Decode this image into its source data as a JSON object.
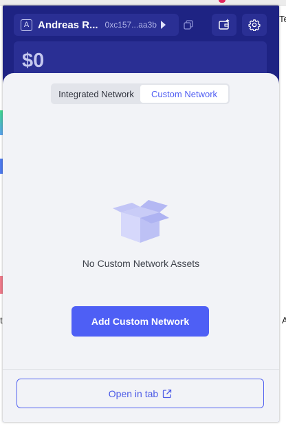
{
  "background": {
    "right_letters": [
      "Te",
      "A"
    ],
    "left_letter": "t"
  },
  "header": {
    "account_badge": "A",
    "account_name": "Andreas R...",
    "address": "0xc157...aa3b",
    "play_icon": "play-icon",
    "copy_icon": "copy-icon",
    "wallet_icon": "wallet-add-icon",
    "settings_icon": "gear-icon"
  },
  "balance": {
    "amount": "$0"
  },
  "tabs": {
    "items": [
      {
        "label": "Integrated Network",
        "active": false
      },
      {
        "label": "Custom Network",
        "active": true
      }
    ]
  },
  "empty_state": {
    "icon": "empty-box-icon",
    "message": "No Custom Network Assets"
  },
  "actions": {
    "add_label": "Add Custom Network",
    "open_tab_label": "Open in tab",
    "open_tab_icon": "external-link-icon"
  },
  "colors": {
    "header_bg": "#1e2383",
    "primary": "#4e5ff5",
    "sheet_bg": "#f2f3f7"
  }
}
